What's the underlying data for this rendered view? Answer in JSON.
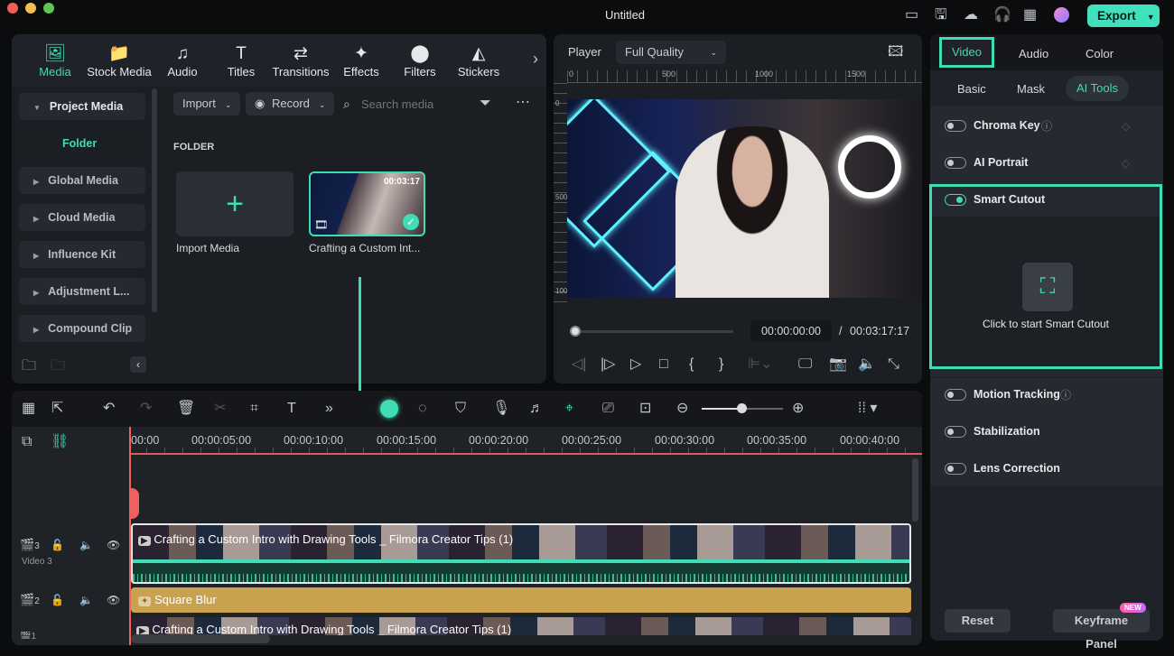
{
  "window": {
    "title": "Untitled"
  },
  "topbar": {
    "export_label": "Export",
    "icons": [
      "layout-icon",
      "save-icon",
      "cloud-upload-icon",
      "headset-icon",
      "apps-icon",
      "avatar"
    ]
  },
  "media_tabs": [
    {
      "label": "Media",
      "icon": "media-icon",
      "active": true
    },
    {
      "label": "Stock Media",
      "icon": "stock-media-icon"
    },
    {
      "label": "Audio",
      "icon": "music-icon"
    },
    {
      "label": "Titles",
      "icon": "titles-icon"
    },
    {
      "label": "Transitions",
      "icon": "transitions-icon"
    },
    {
      "label": "Effects",
      "icon": "effects-icon"
    },
    {
      "label": "Filters",
      "icon": "filters-icon"
    },
    {
      "label": "Stickers",
      "icon": "stickers-icon"
    }
  ],
  "sidebar": {
    "items": [
      {
        "label": "Project Media"
      },
      {
        "label": "Folder"
      },
      {
        "label": "Global Media"
      },
      {
        "label": "Cloud Media"
      },
      {
        "label": "Influence Kit"
      },
      {
        "label": "Adjustment L..."
      },
      {
        "label": "Compound Clip"
      }
    ]
  },
  "media_toolbar": {
    "import_label": "Import",
    "record_label": "Record",
    "search_placeholder": "Search media"
  },
  "media_grid": {
    "folder_heading": "FOLDER",
    "items": [
      {
        "label": "Import Media"
      },
      {
        "label": "Crafting a Custom Int...",
        "duration": "00:03:17"
      }
    ]
  },
  "player": {
    "label": "Player",
    "quality": "Full Quality",
    "ruler": [
      "0",
      "500",
      "1000",
      "1500"
    ],
    "vruler": [
      "0",
      "500",
      "1000"
    ],
    "current_time": "00:00:00:00",
    "separator": "/",
    "total_time": "00:03:17:17",
    "progress": 0
  },
  "right_panel": {
    "tabs": [
      "Video",
      "Audio",
      "Color"
    ],
    "active_tab": "Video",
    "subtabs": [
      "Basic",
      "Mask",
      "AI Tools"
    ],
    "active_subtab": "AI Tools",
    "tools": [
      {
        "label": "Chroma Key",
        "on": false
      },
      {
        "label": "AI Portrait",
        "on": false
      },
      {
        "label": "Smart Cutout",
        "on": true
      },
      {
        "label": "Motion Tracking",
        "on": false
      },
      {
        "label": "Stabilization",
        "on": false
      },
      {
        "label": "Lens Correction",
        "on": false
      }
    ],
    "smart_cutout_prompt": "Click to start Smart Cutout",
    "reset_label": "Reset",
    "keyframe_label": "Keyframe Panel",
    "new_badge": "NEW"
  },
  "timeline": {
    "ruler": [
      "00:00",
      "00:00:05:00",
      "00:00:10:00",
      "00:00:15:00",
      "00:00:20:00",
      "00:00:25:00",
      "00:00:30:00",
      "00:00:35:00",
      "00:00:40:00"
    ],
    "tracks": [
      {
        "number": "3",
        "name": "Video 3",
        "clip": "Crafting a Custom Intro with Drawing Tools _ Filmora Creator Tips (1)"
      },
      {
        "number": "2",
        "clip": "Square Blur"
      },
      {
        "number": "1",
        "clip": "Crafting a Custom Intro with Drawing Tools _ Filmora Creator Tips (1)"
      }
    ]
  },
  "colors": {
    "accent": "#3fdcb5",
    "playhead": "#f0605e",
    "effect_clip": "#c9a24f"
  }
}
